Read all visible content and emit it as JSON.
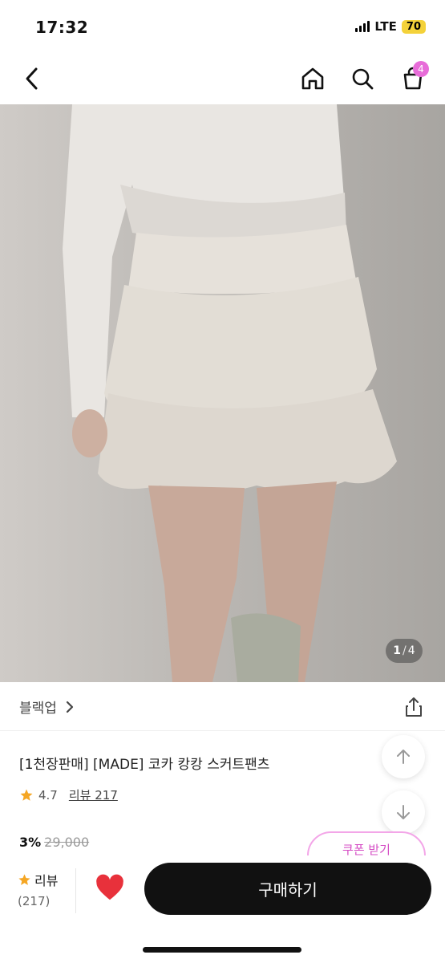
{
  "status": {
    "time": "17:32",
    "network": "LTE",
    "battery": "70"
  },
  "nav": {
    "cart_count": "4"
  },
  "gallery": {
    "current": "1",
    "separator": "/",
    "total": "4"
  },
  "product": {
    "brand": "블랙업",
    "title": "[1천장판매] [MADE] 코카 캉캉 스커트팬츠",
    "rating": "4.7",
    "review_label": "리뷰 217",
    "discount": "3%",
    "original_price": "29,000",
    "coupon_label": "쿠폰 받기"
  },
  "bottom": {
    "review_label": "리뷰",
    "review_count": "(217)",
    "buy_label": "구매하기"
  },
  "colors": {
    "accent_pink": "#e76cd8",
    "star": "#f5a623",
    "heart": "#e8313b",
    "buy_button": "#111111"
  },
  "icons": [
    "back-icon",
    "home-icon",
    "search-icon",
    "cart-icon",
    "share-icon",
    "chevron-right-icon",
    "star-icon",
    "arrow-up-icon",
    "arrow-down-icon",
    "heart-icon"
  ]
}
